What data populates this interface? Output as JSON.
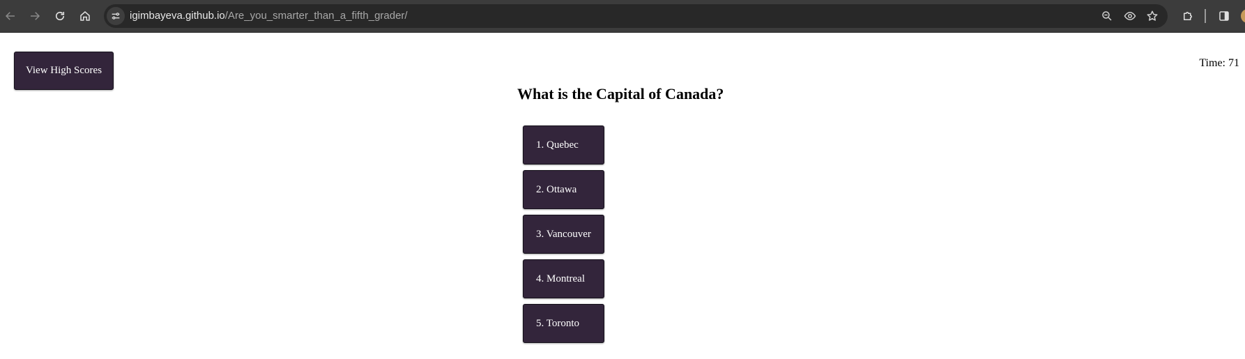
{
  "browser": {
    "url_host": "igimbayeva.github.io",
    "url_path": "/Are_you_smarter_than_a_fifth_grader/"
  },
  "header": {
    "high_scores_label": "View High Scores",
    "timer_label": "Time:",
    "timer_value": "71"
  },
  "quiz": {
    "question": "What is the Capital of Canada?",
    "choices": [
      {
        "label": "1. Quebec"
      },
      {
        "label": "2. Ottawa"
      },
      {
        "label": "3. Vancouver"
      },
      {
        "label": "4. Montreal"
      },
      {
        "label": "5. Toronto"
      }
    ]
  },
  "colors": {
    "button_bg": "#33253b",
    "button_text": "#ffffff",
    "browser_chrome": "#3c3c3c"
  }
}
